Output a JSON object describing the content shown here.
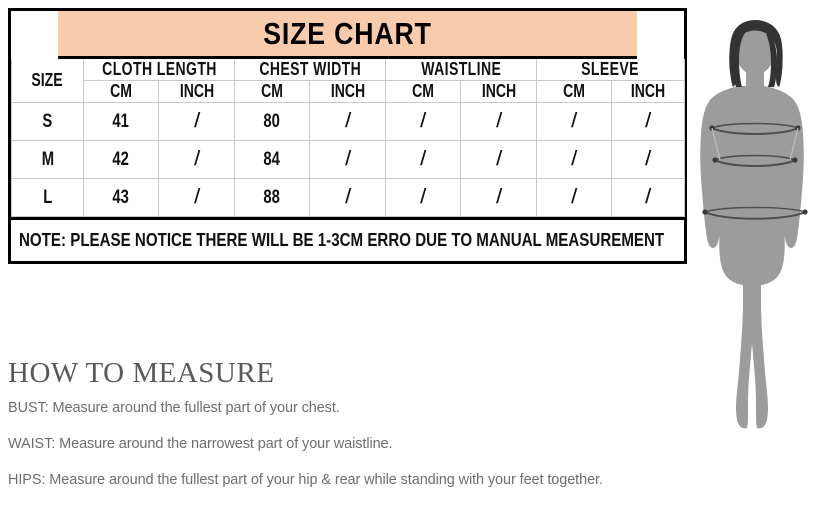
{
  "chart": {
    "title": "SIZE CHART",
    "size_column_label": "SIZE",
    "groups": [
      "CLOTH LENGTH",
      "CHEST WIDTH",
      "WAISTLINE",
      "SLEEVE"
    ],
    "units": [
      "CM",
      "INCH",
      "CM",
      "INCH",
      "CM",
      "INCH",
      "CM",
      "INCH"
    ],
    "rows": [
      {
        "size": "S",
        "values": [
          "41",
          "/",
          "80",
          "/",
          "/",
          "/",
          "/",
          "/"
        ]
      },
      {
        "size": "M",
        "values": [
          "42",
          "/",
          "84",
          "/",
          "/",
          "/",
          "/",
          "/"
        ]
      },
      {
        "size": "L",
        "values": [
          "43",
          "/",
          "88",
          "/",
          "/",
          "/",
          "/",
          "/"
        ]
      }
    ],
    "note": "NOTE: PLEASE NOTICE THERE WILL BE 1-3CM ERRO DUE TO MANUAL MEASUREMENT",
    "header_color": "#f7cbac",
    "border_color": "#000000",
    "grid_color": "#c9c9c9"
  },
  "how_to_measure": {
    "title": "HOW TO MEASURE",
    "lines": [
      "BUST: Measure around the fullest part of your chest.",
      "WAIST: Measure around the narrowest part of your waistline.",
      "HIPS: Measure around the fullest part of your hip & rear while standing with your feet together."
    ]
  },
  "figure": {
    "name": "female-body-silhouette",
    "body_color": "#9c9c9c",
    "hair_color": "#333333",
    "measure_line_color": "#4d4d4d",
    "measure_bands": [
      "bust",
      "waist",
      "hips"
    ]
  }
}
